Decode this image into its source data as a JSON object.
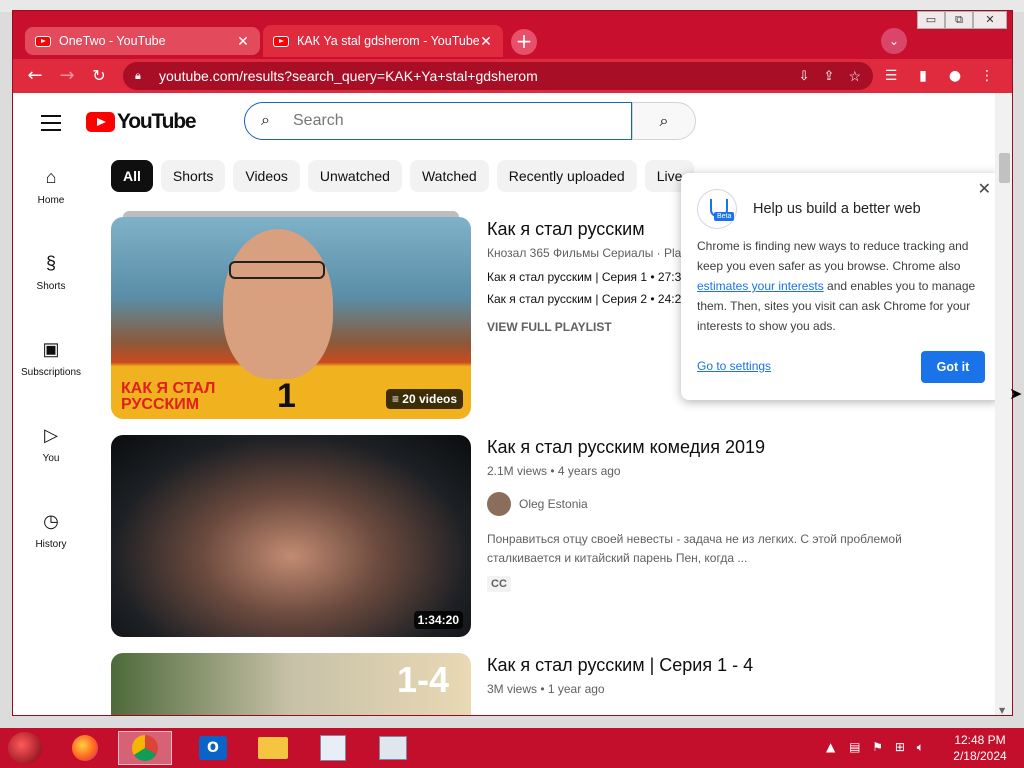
{
  "browser": {
    "tabs": [
      {
        "title": "OneTwo - YouTube",
        "close": "✕"
      },
      {
        "title": "КАК Ya stal gdsherom - YouTube",
        "close": "✕"
      }
    ],
    "new_tab": "+",
    "tab_search": "⌄",
    "url": "youtube.com/results?search_query=KAK+Ya+stal+gdsherom",
    "window_controls": [
      "▭",
      "⧉",
      "✕"
    ],
    "colors": {
      "frame": "#c8102e",
      "accent": "#1a73e8"
    }
  },
  "youtube": {
    "logo_text": "YouTube",
    "search_placeholder": "Search",
    "sidebar": [
      {
        "label": "Home",
        "icon": "home-icon"
      },
      {
        "label": "Shorts",
        "icon": "shorts-icon"
      },
      {
        "label": "Subscriptions",
        "icon": "subscriptions-icon"
      },
      {
        "label": "You",
        "icon": "you-icon"
      },
      {
        "label": "History",
        "icon": "history-icon"
      }
    ],
    "chips": [
      "All",
      "Shorts",
      "Videos",
      "Unwatched",
      "Watched",
      "Recently uploaded",
      "Live"
    ],
    "results": [
      {
        "title": "Как я стал русским",
        "subtitle": "Кнозал 365 Фильмы Сериалы · Pla",
        "lines": [
          "Как я стал русским | Серия 1 • 27:3",
          "Как я стал русским | Серия 2 • 24:2"
        ],
        "action": "VIEW FULL PLAYLIST",
        "badge": "20 videos",
        "thumb_text": "КАК Я СТАЛ РУССКИМ",
        "thumb_number": "1"
      },
      {
        "title": "Как я стал русским комедия 2019",
        "subtitle": "2.1M views • 4 years ago",
        "channel": "Oleg Estonia",
        "description": "Понравиться отцу своей невесты - задача не из легких. С этой проблемой сталкивается и китайский парень Пен, когда ...",
        "cc": "CC",
        "duration": "1:34:20"
      },
      {
        "title": "Как я стал русским | Серия 1 - 4",
        "subtitle": "3M views • 1 year ago",
        "thumb_text": "1-4"
      }
    ]
  },
  "popup": {
    "badge": "Beta",
    "title": "Help us build a better web",
    "body_1": "Chrome is finding new ways to reduce tracking and keep you even safer as you browse. Chrome also ",
    "link": "estimates your interests",
    "body_2": " and enables you to manage them. Then, sites you visit can ask Chrome for your interests to show you ads.",
    "settings_link": "Go to settings",
    "button": "Got it",
    "close": "✕"
  },
  "taskbar": {
    "time": "12:48 PM",
    "date": "2/18/2024"
  }
}
